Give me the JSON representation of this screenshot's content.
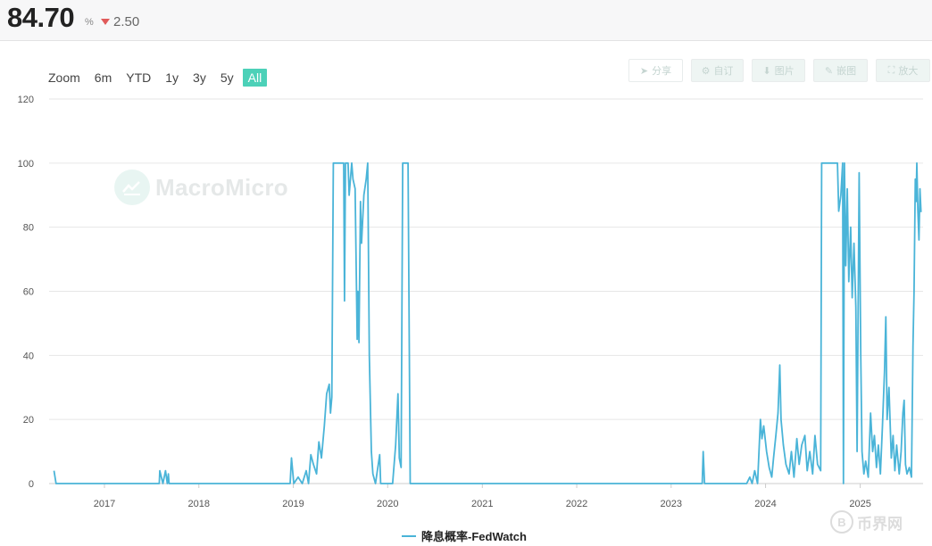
{
  "header": {
    "value": "84.70",
    "unit": "%",
    "change": "2.50",
    "change_direction": "down",
    "change_color": "#e05a5a"
  },
  "zoom": {
    "label": "Zoom",
    "options": [
      "6m",
      "YTD",
      "1y",
      "3y",
      "5y",
      "All"
    ],
    "active": "All"
  },
  "toolbar": {
    "share": "分享",
    "customize": "自订",
    "image": "图片",
    "embed": "嵌图",
    "expand": "放大"
  },
  "watermark": {
    "brand": "MacroMicro",
    "site": "币界网",
    "site_glyph": "B"
  },
  "colors": {
    "series": "#4ab4d8",
    "active_zoom": "#4cd1b8",
    "grid": "#e6e6e6"
  },
  "chart_data": {
    "type": "line",
    "title": "",
    "xlabel": "",
    "ylabel": "",
    "xlim": [
      "2016-06",
      "2025-09"
    ],
    "ylim": [
      0,
      120
    ],
    "yticks": [
      0,
      20,
      40,
      60,
      80,
      100,
      120
    ],
    "xticks": [
      "2017",
      "2018",
      "2019",
      "2020",
      "2021",
      "2022",
      "2023",
      "2024",
      "2025"
    ],
    "grid": true,
    "legend": "bottom-center",
    "series": [
      {
        "name": "降息概率-FedWatch",
        "points": [
          [
            "2016-06-20",
            4
          ],
          [
            "2016-06-28",
            0
          ],
          [
            "2017-08-01",
            0
          ],
          [
            "2017-08-03",
            4
          ],
          [
            "2017-08-15",
            0
          ],
          [
            "2017-08-25",
            4
          ],
          [
            "2017-09-01",
            0
          ],
          [
            "2017-09-05",
            3
          ],
          [
            "2017-09-08",
            0
          ],
          [
            "2018-12-20",
            0
          ],
          [
            "2018-12-25",
            8
          ],
          [
            "2019-01-03",
            0
          ],
          [
            "2019-01-20",
            2
          ],
          [
            "2019-02-05",
            0
          ],
          [
            "2019-02-20",
            4
          ],
          [
            "2019-03-01",
            0
          ],
          [
            "2019-03-10",
            9
          ],
          [
            "2019-03-20",
            6
          ],
          [
            "2019-04-01",
            3
          ],
          [
            "2019-04-10",
            13
          ],
          [
            "2019-04-20",
            8
          ],
          [
            "2019-05-01",
            18
          ],
          [
            "2019-05-10",
            28
          ],
          [
            "2019-05-20",
            31
          ],
          [
            "2019-05-25",
            22
          ],
          [
            "2019-05-30",
            27
          ],
          [
            "2019-06-05",
            100
          ],
          [
            "2019-07-15",
            100
          ],
          [
            "2019-07-18",
            57
          ],
          [
            "2019-07-22",
            100
          ],
          [
            "2019-08-01",
            100
          ],
          [
            "2019-08-05",
            90
          ],
          [
            "2019-08-15",
            100
          ],
          [
            "2019-08-20",
            95
          ],
          [
            "2019-08-28",
            92
          ],
          [
            "2019-09-05",
            45
          ],
          [
            "2019-09-08",
            60
          ],
          [
            "2019-09-12",
            44
          ],
          [
            "2019-09-18",
            88
          ],
          [
            "2019-09-22",
            75
          ],
          [
            "2019-10-01",
            90
          ],
          [
            "2019-10-10",
            95
          ],
          [
            "2019-10-16",
            100
          ],
          [
            "2019-10-22",
            40
          ],
          [
            "2019-10-30",
            10
          ],
          [
            "2019-11-05",
            3
          ],
          [
            "2019-11-15",
            0
          ],
          [
            "2019-12-01",
            9
          ],
          [
            "2019-12-05",
            0
          ],
          [
            "2020-01-20",
            0
          ],
          [
            "2020-02-01",
            12
          ],
          [
            "2020-02-10",
            28
          ],
          [
            "2020-02-15",
            8
          ],
          [
            "2020-02-22",
            5
          ],
          [
            "2020-02-28",
            100
          ],
          [
            "2020-03-20",
            100
          ],
          [
            "2020-03-28",
            0
          ],
          [
            "2023-05-01",
            0
          ],
          [
            "2023-05-05",
            10
          ],
          [
            "2023-05-10",
            0
          ],
          [
            "2023-10-20",
            0
          ],
          [
            "2023-11-01",
            2
          ],
          [
            "2023-11-10",
            0
          ],
          [
            "2023-11-20",
            4
          ],
          [
            "2023-12-01",
            0
          ],
          [
            "2023-12-12",
            20
          ],
          [
            "2023-12-18",
            14
          ],
          [
            "2023-12-25",
            18
          ],
          [
            "2024-01-05",
            10
          ],
          [
            "2024-01-15",
            5
          ],
          [
            "2024-01-25",
            2
          ],
          [
            "2024-02-01",
            8
          ],
          [
            "2024-02-10",
            15
          ],
          [
            "2024-02-18",
            22
          ],
          [
            "2024-02-25",
            37
          ],
          [
            "2024-03-01",
            20
          ],
          [
            "2024-03-10",
            12
          ],
          [
            "2024-03-20",
            6
          ],
          [
            "2024-04-01",
            3
          ],
          [
            "2024-04-10",
            10
          ],
          [
            "2024-04-20",
            2
          ],
          [
            "2024-05-01",
            14
          ],
          [
            "2024-05-10",
            6
          ],
          [
            "2024-05-20",
            12
          ],
          [
            "2024-06-01",
            15
          ],
          [
            "2024-06-10",
            4
          ],
          [
            "2024-06-20",
            10
          ],
          [
            "2024-07-01",
            3
          ],
          [
            "2024-07-10",
            15
          ],
          [
            "2024-07-20",
            6
          ],
          [
            "2024-08-01",
            4
          ],
          [
            "2024-08-05",
            100
          ],
          [
            "2024-10-05",
            100
          ],
          [
            "2024-10-10",
            85
          ],
          [
            "2024-10-18",
            90
          ],
          [
            "2024-10-25",
            100
          ],
          [
            "2024-10-28",
            0
          ],
          [
            "2024-11-01",
            100
          ],
          [
            "2024-11-06",
            68
          ],
          [
            "2024-11-12",
            92
          ],
          [
            "2024-11-18",
            63
          ],
          [
            "2024-11-25",
            80
          ],
          [
            "2024-12-01",
            58
          ],
          [
            "2024-12-08",
            75
          ],
          [
            "2024-12-15",
            55
          ],
          [
            "2024-12-20",
            10
          ],
          [
            "2024-12-28",
            97
          ],
          [
            "2025-01-03",
            40
          ],
          [
            "2025-01-08",
            10
          ],
          [
            "2025-01-15",
            3
          ],
          [
            "2025-01-22",
            7
          ],
          [
            "2025-02-01",
            2
          ],
          [
            "2025-02-10",
            22
          ],
          [
            "2025-02-18",
            10
          ],
          [
            "2025-02-25",
            15
          ],
          [
            "2025-03-05",
            5
          ],
          [
            "2025-03-12",
            12
          ],
          [
            "2025-03-20",
            3
          ],
          [
            "2025-03-28",
            18
          ],
          [
            "2025-04-05",
            35
          ],
          [
            "2025-04-10",
            52
          ],
          [
            "2025-04-15",
            20
          ],
          [
            "2025-04-22",
            30
          ],
          [
            "2025-05-01",
            8
          ],
          [
            "2025-05-08",
            15
          ],
          [
            "2025-05-15",
            4
          ],
          [
            "2025-05-22",
            12
          ],
          [
            "2025-06-01",
            3
          ],
          [
            "2025-06-08",
            10
          ],
          [
            "2025-06-15",
            22
          ],
          [
            "2025-06-20",
            26
          ],
          [
            "2025-06-25",
            6
          ],
          [
            "2025-07-01",
            3
          ],
          [
            "2025-07-10",
            5
          ],
          [
            "2025-07-18",
            2
          ],
          [
            "2025-07-24",
            43
          ],
          [
            "2025-07-28",
            60
          ],
          [
            "2025-08-02",
            95
          ],
          [
            "2025-08-05",
            88
          ],
          [
            "2025-08-08",
            100
          ],
          [
            "2025-08-12",
            85
          ],
          [
            "2025-08-16",
            76
          ],
          [
            "2025-08-20",
            92
          ],
          [
            "2025-08-24",
            84.7
          ]
        ]
      }
    ]
  }
}
